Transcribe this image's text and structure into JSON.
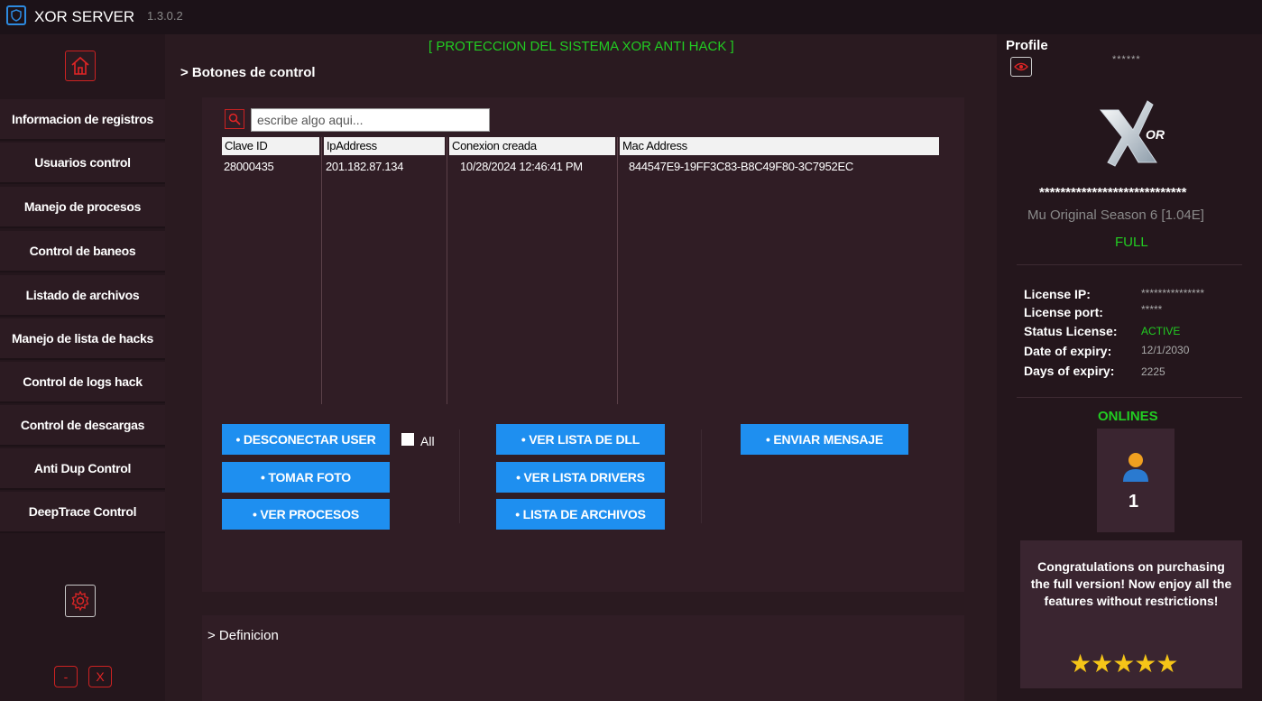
{
  "app": {
    "title": "XOR SERVER",
    "version": "1.3.0.2"
  },
  "sidebar": {
    "items": [
      {
        "label": "Informacion de registros"
      },
      {
        "label": "Usuarios control"
      },
      {
        "label": "Manejo de procesos"
      },
      {
        "label": "Control de baneos"
      },
      {
        "label": "Listado de archivos"
      },
      {
        "label": "Manejo de lista de hacks"
      },
      {
        "label": "Control de logs hack"
      },
      {
        "label": "Control de descargas"
      },
      {
        "label": "Anti Dup Control"
      },
      {
        "label": "DeepTrace Control"
      }
    ],
    "minimize_label": "-",
    "close_label": "X"
  },
  "main": {
    "header": "[ PROTECCION DEL SISTEMA XOR ANTI HACK ]",
    "section_title": "> Botones de control",
    "search_placeholder": "escribe algo aqui...",
    "table": {
      "columns": [
        "Clave ID",
        "IpAddress",
        "Conexion creada",
        "Mac Address"
      ],
      "rows": [
        [
          "28000435",
          "201.182.87.134",
          "10/28/2024 12:46:41 PM",
          "844547E9-19FF3C83-B8C49F80-3C7952EC"
        ]
      ]
    },
    "buttons": {
      "disconnect": "• DESCONECTAR USER",
      "all_label": "All",
      "photo": "• TOMAR FOTO",
      "processes": "• VER PROCESOS",
      "dll_list": "• VER LISTA DE DLL",
      "drivers": "• VER LISTA DRIVERS",
      "files": "• LISTA DE ARCHIVOS",
      "message": "• ENVIAR MENSAJE"
    },
    "definition_title": "> Definicion"
  },
  "right": {
    "profile_label": "Profile",
    "profile_name": "******",
    "masked_code": "****************************",
    "server_version": "Mu Original Season 6 [1.04E]",
    "edition": "FULL",
    "license": {
      "ip_key": "License IP:",
      "ip_val": "***************",
      "port_key": "License port:",
      "port_val": "*****",
      "status_key": "Status License:",
      "status_val": "ACTIVE",
      "expiry_key": "Date of expiry:",
      "expiry_val": "12/1/2030",
      "days_key": "Days of expiry:",
      "days_val": "2225"
    },
    "onlines_label": "ONLINES",
    "onlines_count": "1",
    "congrats": "Congratulations on purchasing the full version! Now enjoy all the features without restrictions!",
    "rating": 5,
    "stars": "★★★★★"
  },
  "colors": {
    "accent": "#1e8ff0",
    "green": "#22cc22",
    "red": "#cc2222",
    "bg": "#2a1a20"
  }
}
